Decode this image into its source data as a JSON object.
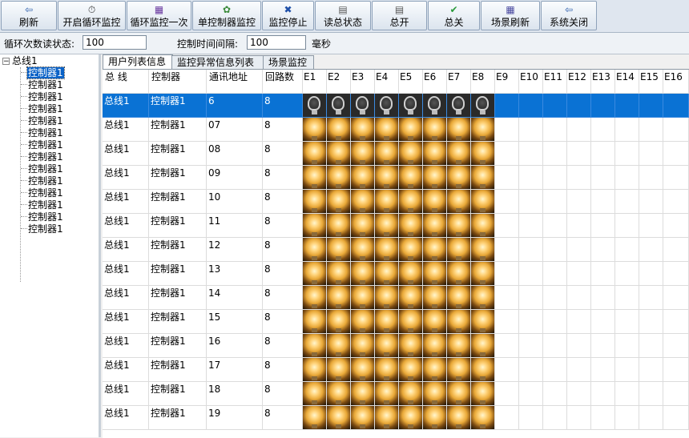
{
  "toolbar": {
    "buttons": [
      {
        "id": "refresh",
        "label": "刷新",
        "icon": "refresh-icon",
        "glyph": "⇦",
        "color": "#2a5caa"
      },
      {
        "id": "start-loop",
        "label": "开启循环监控",
        "icon": "clock-icon",
        "glyph": "⏱",
        "color": "#333333"
      },
      {
        "id": "loop-once",
        "label": "循环监控一次",
        "icon": "grid-icon",
        "glyph": "▦",
        "color": "#6a3aa0"
      },
      {
        "id": "single-controller",
        "label": "单控制器监控",
        "icon": "palette-icon",
        "glyph": "✿",
        "color": "#3a8a3a"
      },
      {
        "id": "stop",
        "label": "监控停止",
        "icon": "close-icon",
        "glyph": "✖",
        "color": "#1f4fa8"
      },
      {
        "id": "read-status",
        "label": "读总状态",
        "icon": "doc-icon",
        "glyph": "▤",
        "color": "#555555"
      },
      {
        "id": "all-on",
        "label": "总开",
        "icon": "doc-icon",
        "glyph": "▤",
        "color": "#555555"
      },
      {
        "id": "all-off",
        "label": "总关",
        "icon": "check-icon",
        "glyph": "✔",
        "color": "#2a9a3a"
      },
      {
        "id": "scene-refresh",
        "label": "场景刷新",
        "icon": "calendar-icon",
        "glyph": "▦",
        "color": "#4a4aa0"
      },
      {
        "id": "close",
        "label": "系统关闭",
        "icon": "exit-icon",
        "glyph": "⇦",
        "color": "#2a5caa"
      }
    ]
  },
  "params": {
    "loop_count_label": "循环次数读状态:",
    "loop_count_value": "100",
    "interval_label": "控制时间间隔:",
    "interval_value": "100",
    "interval_unit": "毫秒"
  },
  "tree": {
    "root": "总线1",
    "items": [
      "控制器1",
      "控制器1",
      "控制器1",
      "控制器1",
      "控制器1",
      "控制器1",
      "控制器1",
      "控制器1",
      "控制器1",
      "控制器1",
      "控制器1",
      "控制器1",
      "控制器1",
      "控制器1"
    ],
    "selected_index": 0
  },
  "tabs": [
    {
      "label": "用户列表信息",
      "active": true
    },
    {
      "label": "监控异常信息列表",
      "active": false
    },
    {
      "label": "场景监控",
      "active": false
    }
  ],
  "grid": {
    "headers": [
      "总  线",
      "控制器",
      "通讯地址",
      "回路数",
      "E1",
      "E2",
      "E3",
      "E4",
      "E5",
      "E6",
      "E7",
      "E8",
      "E9",
      "E10",
      "E11",
      "E12",
      "E13",
      "E14",
      "E15",
      "E16"
    ],
    "rows": [
      {
        "bus": "总线1",
        "controller": "控制器1",
        "address": "6",
        "loops": "8",
        "state": "off",
        "selected": true
      },
      {
        "bus": "总线1",
        "controller": "控制器1",
        "address": "07",
        "loops": "8",
        "state": "on",
        "selected": false
      },
      {
        "bus": "总线1",
        "controller": "控制器1",
        "address": "08",
        "loops": "8",
        "state": "on",
        "selected": false
      },
      {
        "bus": "总线1",
        "controller": "控制器1",
        "address": "09",
        "loops": "8",
        "state": "on",
        "selected": false
      },
      {
        "bus": "总线1",
        "controller": "控制器1",
        "address": "10",
        "loops": "8",
        "state": "on",
        "selected": false
      },
      {
        "bus": "总线1",
        "controller": "控制器1",
        "address": "11",
        "loops": "8",
        "state": "on",
        "selected": false
      },
      {
        "bus": "总线1",
        "controller": "控制器1",
        "address": "12",
        "loops": "8",
        "state": "on",
        "selected": false
      },
      {
        "bus": "总线1",
        "controller": "控制器1",
        "address": "13",
        "loops": "8",
        "state": "on",
        "selected": false
      },
      {
        "bus": "总线1",
        "controller": "控制器1",
        "address": "14",
        "loops": "8",
        "state": "on",
        "selected": false
      },
      {
        "bus": "总线1",
        "controller": "控制器1",
        "address": "15",
        "loops": "8",
        "state": "on",
        "selected": false
      },
      {
        "bus": "总线1",
        "controller": "控制器1",
        "address": "16",
        "loops": "8",
        "state": "on",
        "selected": false
      },
      {
        "bus": "总线1",
        "controller": "控制器1",
        "address": "17",
        "loops": "8",
        "state": "on",
        "selected": false
      },
      {
        "bus": "总线1",
        "controller": "控制器1",
        "address": "18",
        "loops": "8",
        "state": "on",
        "selected": false
      },
      {
        "bus": "总线1",
        "controller": "控制器1",
        "address": "19",
        "loops": "8",
        "state": "on",
        "selected": false
      }
    ]
  }
}
